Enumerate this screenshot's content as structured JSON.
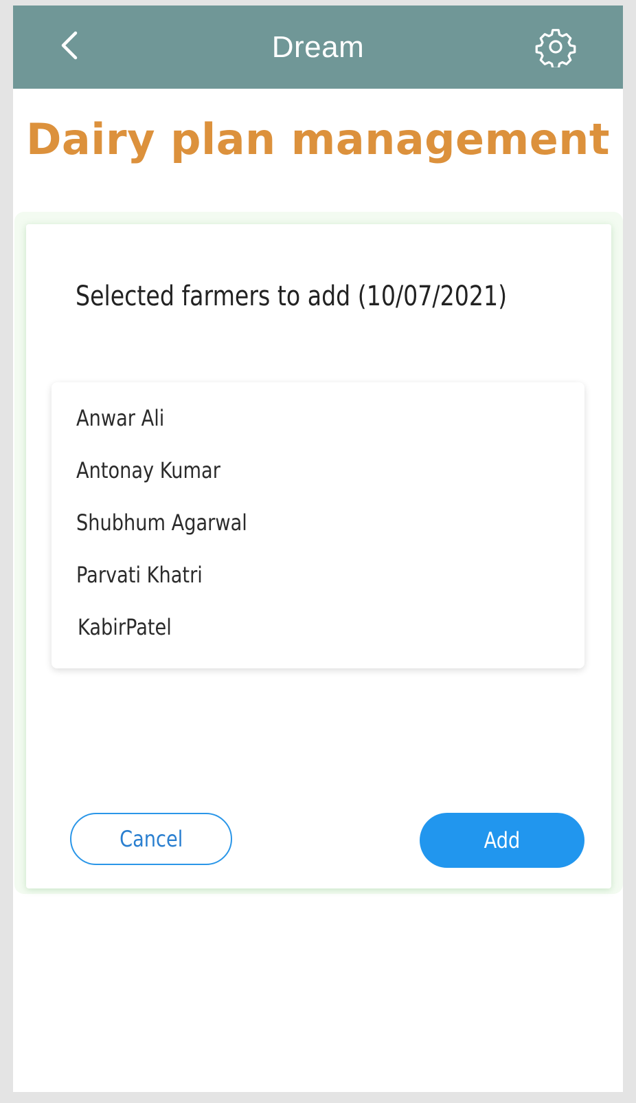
{
  "header": {
    "title": "Dream",
    "back_icon": "chevron-left-icon",
    "settings_icon": "gear-icon",
    "background_color": "#709797"
  },
  "page": {
    "title": "Dairy plan management",
    "title_color": "#dc913c"
  },
  "card": {
    "heading": "Selected farmers to add (10/07/2021)",
    "farmers": [
      "Anwar Ali",
      "Antonay Kumar",
      "Shubhum Agarwal",
      "Parvati Khatri",
      "KabirPatel"
    ]
  },
  "actions": {
    "cancel_label": "Cancel",
    "add_label": "Add",
    "primary_color": "#2196ee"
  }
}
